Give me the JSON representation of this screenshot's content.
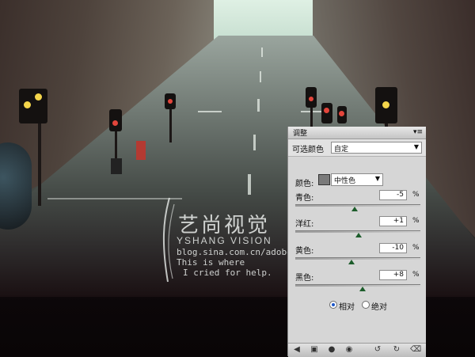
{
  "panel": {
    "tab_title": "调整",
    "menu_icon": "panel-menu-icon",
    "preset_label": "可选颜色",
    "preset_value": "自定",
    "colors_label": "颜色:",
    "colors_value": "中性色",
    "sliders": [
      {
        "label": "青色:",
        "value": "-5",
        "unit": "%",
        "level": -5
      },
      {
        "label": "洋红:",
        "value": "+1",
        "unit": "%",
        "level": 1
      },
      {
        "label": "黄色:",
        "value": "-10",
        "unit": "%",
        "level": -10
      },
      {
        "label": "黑色:",
        "value": "+8",
        "unit": "%",
        "level": 8
      }
    ],
    "method_relative": "相对",
    "method_absolute": "绝对",
    "method_selected": "relative",
    "thumb_color": "#1d5d2b",
    "bottom_icons": [
      "back-icon",
      "clip-layer-icon",
      "visibility-eye-icon",
      "view-previous-icon",
      "reset-icon",
      "delete-icon"
    ]
  },
  "watermark": {
    "chinese": "艺尚视觉",
    "english": "YSHANG VISION",
    "url": "blog.sina.com.cn/adobech",
    "line1": "This is where",
    "line2": "I cried for help."
  }
}
